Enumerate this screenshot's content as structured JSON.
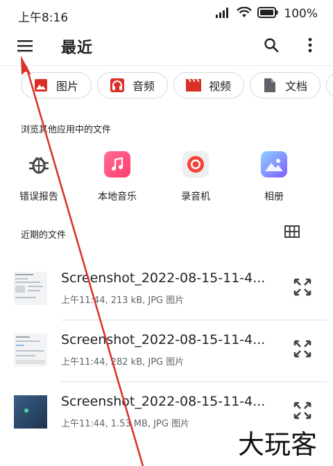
{
  "status_bar": {
    "time": "上午8:16",
    "battery": "100%"
  },
  "app_bar": {
    "title": "最近"
  },
  "chips": [
    {
      "label": "图片",
      "icon": "image-icon",
      "color": "#d93025"
    },
    {
      "label": "音频",
      "icon": "headphones-icon",
      "color": "#d93025"
    },
    {
      "label": "视频",
      "icon": "movie-icon",
      "color": "#d93025"
    },
    {
      "label": "文档",
      "icon": "document-icon",
      "color": "#5f6368"
    },
    {
      "label": "",
      "icon": "tag-icon",
      "color": "#5f6368"
    }
  ],
  "browse": {
    "label": "浏览其他应用中的文件",
    "apps": [
      {
        "label": "错误报告",
        "icon": "bug-icon"
      },
      {
        "label": "本地音乐",
        "icon": "music-icon",
        "color": "#ff4f7a"
      },
      {
        "label": "录音机",
        "icon": "recorder-icon",
        "color": "#f44336"
      },
      {
        "label": "相册",
        "icon": "gallery-icon",
        "color": "#7b8cff"
      }
    ]
  },
  "recent": {
    "label": "近期的文件",
    "files": [
      {
        "name": "Screenshot_2022-08-15-11-4...",
        "meta": "上午11:44, 213 kB, JPG 图片"
      },
      {
        "name": "Screenshot_2022-08-15-11-4...",
        "meta": "上午11:44, 282 kB, JPG 图片"
      },
      {
        "name": "Screenshot_2022-08-15-11-4...",
        "meta": "上午11:44, 1.53 MB, JPG 图片"
      }
    ]
  },
  "watermark": {
    "text": "大玩客"
  },
  "colors": {
    "annotation_arrow": "#d9342b",
    "icon_gray": "#5f6368"
  }
}
